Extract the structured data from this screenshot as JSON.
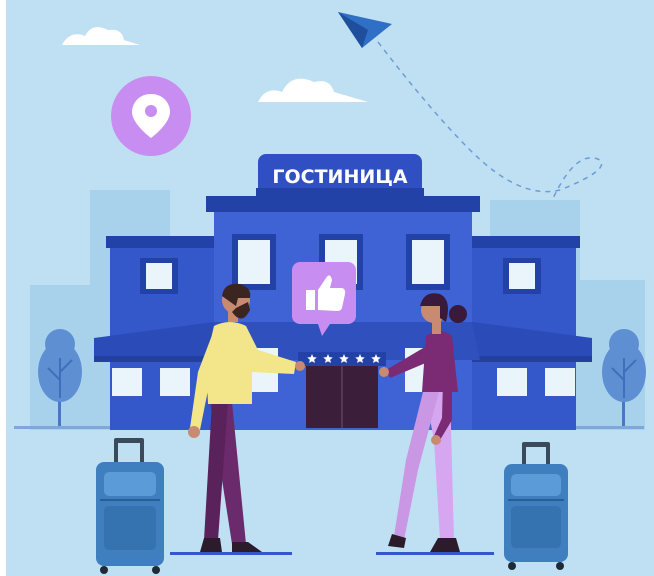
{
  "hotel_sign": {
    "label": "ГОСТИНИЦА"
  },
  "rating": {
    "stars": 5,
    "max": 5
  },
  "colors": {
    "sky": "#bfe0f3",
    "background_buildings": "#a8d2ec",
    "building_main": "#3457c9",
    "building_dark": "#2342a8",
    "building_light": "#4a6fe0",
    "window": "#e9f4fb",
    "door": "#3b1f3a",
    "pin": "#c88df0",
    "like_bubble": "#c88df0",
    "suitcase": "#3f7fc0",
    "man_shirt": "#f3e58a",
    "man_pants": "#6b2a6b",
    "woman_top": "#7a2b74",
    "woman_pants": "#d7a6f0",
    "tree": "#5e8fd3",
    "plane": "#2f6fc6"
  },
  "icons": [
    "location-pin-icon",
    "thumbs-up-icon",
    "paper-plane-icon",
    "star-icon"
  ]
}
